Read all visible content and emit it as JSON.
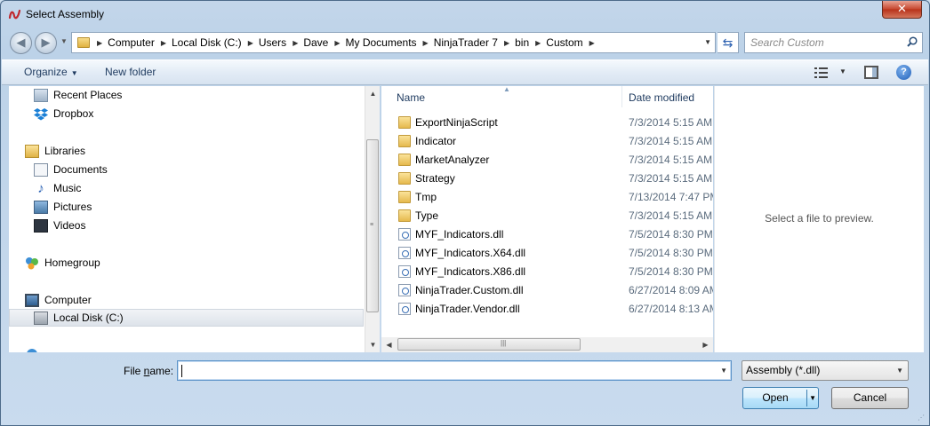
{
  "window": {
    "title": "Select Assembly"
  },
  "address": {
    "crumbs": [
      "Computer",
      "Local Disk (C:)",
      "Users",
      "Dave",
      "My Documents",
      "NinjaTrader 7",
      "bin",
      "Custom"
    ]
  },
  "search": {
    "placeholder": "Search Custom"
  },
  "toolbar": {
    "organize": "Organize",
    "new_folder": "New folder",
    "help": "?"
  },
  "nav": {
    "items": [
      {
        "label": "Recent Places",
        "icon": "recent-places-icon"
      },
      {
        "label": "Dropbox",
        "icon": "dropbox-icon"
      },
      {
        "label": "Libraries",
        "icon": "libraries-icon"
      },
      {
        "label": "Documents",
        "icon": "documents-icon"
      },
      {
        "label": "Music",
        "icon": "music-icon"
      },
      {
        "label": "Pictures",
        "icon": "pictures-icon"
      },
      {
        "label": "Videos",
        "icon": "videos-icon"
      },
      {
        "label": "Homegroup",
        "icon": "homegroup-icon"
      },
      {
        "label": "Computer",
        "icon": "computer-icon"
      },
      {
        "label": "Local Disk (C:)",
        "icon": "local-disk-icon",
        "selected": true
      }
    ]
  },
  "files": {
    "columns": {
      "name": "Name",
      "date": "Date modified"
    },
    "rows": [
      {
        "name": "ExportNinjaScript",
        "date": "7/3/2014 5:15 AM",
        "type": "folder"
      },
      {
        "name": "Indicator",
        "date": "7/3/2014 5:15 AM",
        "type": "folder"
      },
      {
        "name": "MarketAnalyzer",
        "date": "7/3/2014 5:15 AM",
        "type": "folder"
      },
      {
        "name": "Strategy",
        "date": "7/3/2014 5:15 AM",
        "type": "folder"
      },
      {
        "name": "Tmp",
        "date": "7/13/2014 7:47 PM",
        "type": "folder"
      },
      {
        "name": "Type",
        "date": "7/3/2014 5:15 AM",
        "type": "folder"
      },
      {
        "name": "MYF_Indicators.dll",
        "date": "7/5/2014 8:30 PM",
        "type": "dll"
      },
      {
        "name": "MYF_Indicators.X64.dll",
        "date": "7/5/2014 8:30 PM",
        "type": "dll"
      },
      {
        "name": "MYF_Indicators.X86.dll",
        "date": "7/5/2014 8:30 PM",
        "type": "dll"
      },
      {
        "name": "NinjaTrader.Custom.dll",
        "date": "6/27/2014 8:09 AM",
        "type": "dll"
      },
      {
        "name": "NinjaTrader.Vendor.dll",
        "date": "6/27/2014 8:13 AM",
        "type": "dll"
      }
    ]
  },
  "preview": {
    "text": "Select a file to preview."
  },
  "bottom": {
    "file_name_label": "File name:",
    "file_name_value": "",
    "filter": "Assembly (*.dll)",
    "open": "Open",
    "cancel": "Cancel"
  }
}
